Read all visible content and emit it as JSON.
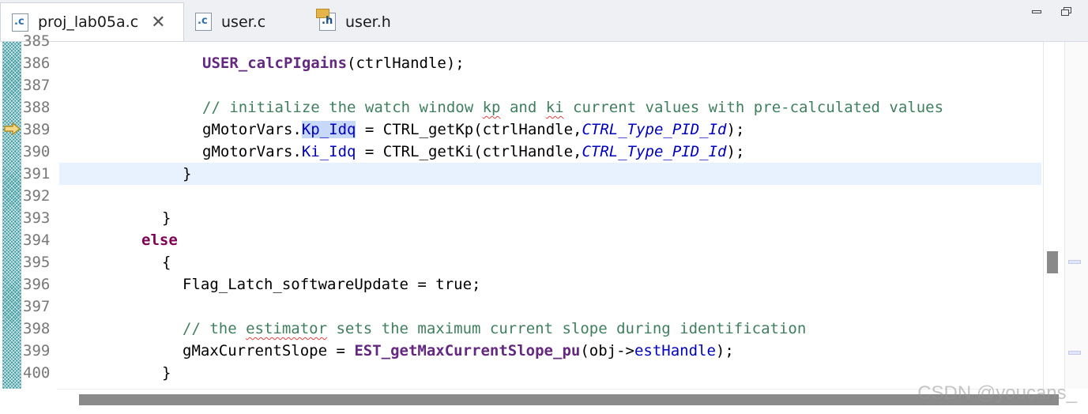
{
  "tabs": [
    {
      "label": "proj_lab05a.c",
      "icon": "c-source-file-icon",
      "icon_letter": ".c",
      "active": true,
      "close": "✕"
    },
    {
      "label": "user.c",
      "icon": "c-source-file-icon",
      "icon_letter": ".c",
      "active": false
    },
    {
      "label": "user.h",
      "icon": "c-header-file-icon",
      "icon_letter": ".h",
      "active": false
    }
  ],
  "editor": {
    "lines": [
      {
        "num": "385"
      },
      {
        "num": "386"
      },
      {
        "num": "387"
      },
      {
        "num": "388"
      },
      {
        "num": "389"
      },
      {
        "num": "390"
      },
      {
        "num": "391"
      },
      {
        "num": "392"
      },
      {
        "num": "393"
      },
      {
        "num": "394"
      },
      {
        "num": "395"
      },
      {
        "num": "396"
      },
      {
        "num": "397"
      },
      {
        "num": "398"
      },
      {
        "num": "399"
      },
      {
        "num": "400"
      }
    ],
    "code": {
      "l386": {
        "fn": "USER_calcPIgains",
        "rest": "(ctrlHandle);"
      },
      "l388": {
        "c1": "// initialize the watch window ",
        "s1": "kp",
        "c2": " and ",
        "s2": "ki",
        "c3": " current values with pre-calculated values"
      },
      "l389": {
        "a": "gMotorVars.",
        "f": "Kp_Idq",
        "b": " = CTRL_getKp(ctrlHandle,",
        "e": "CTRL_Type_PID_Id",
        "c": ");"
      },
      "l390": {
        "a": "gMotorVars.",
        "f": "Ki_Idq",
        "b": " = CTRL_getKi(ctrlHandle,",
        "e": "CTRL_Type_PID_Id",
        "c": ");"
      },
      "l391": "}",
      "l393": "}",
      "l394": "else",
      "l395": "{",
      "l396": "Flag_Latch_softwareUpdate = true;",
      "l398": {
        "c1": "// the ",
        "s1": "estimator",
        "c2": " sets the maximum current slope during identification"
      },
      "l399": {
        "a": "gMaxCurrentSlope = ",
        "fn": "EST_getMaxCurrentSlope_pu",
        "b": "(obj->",
        "f": "estHandle",
        "c": ");"
      },
      "l400": "}"
    },
    "current_line": "391",
    "instruction_pointer_line": "389"
  },
  "watermark": "CSDN @youcans_",
  "colors": {
    "keyword": "#7f0055",
    "comment": "#3f7f5f",
    "field": "#0000c0",
    "current_line": "#e8f2fe",
    "selection": "#c8d8f8"
  }
}
